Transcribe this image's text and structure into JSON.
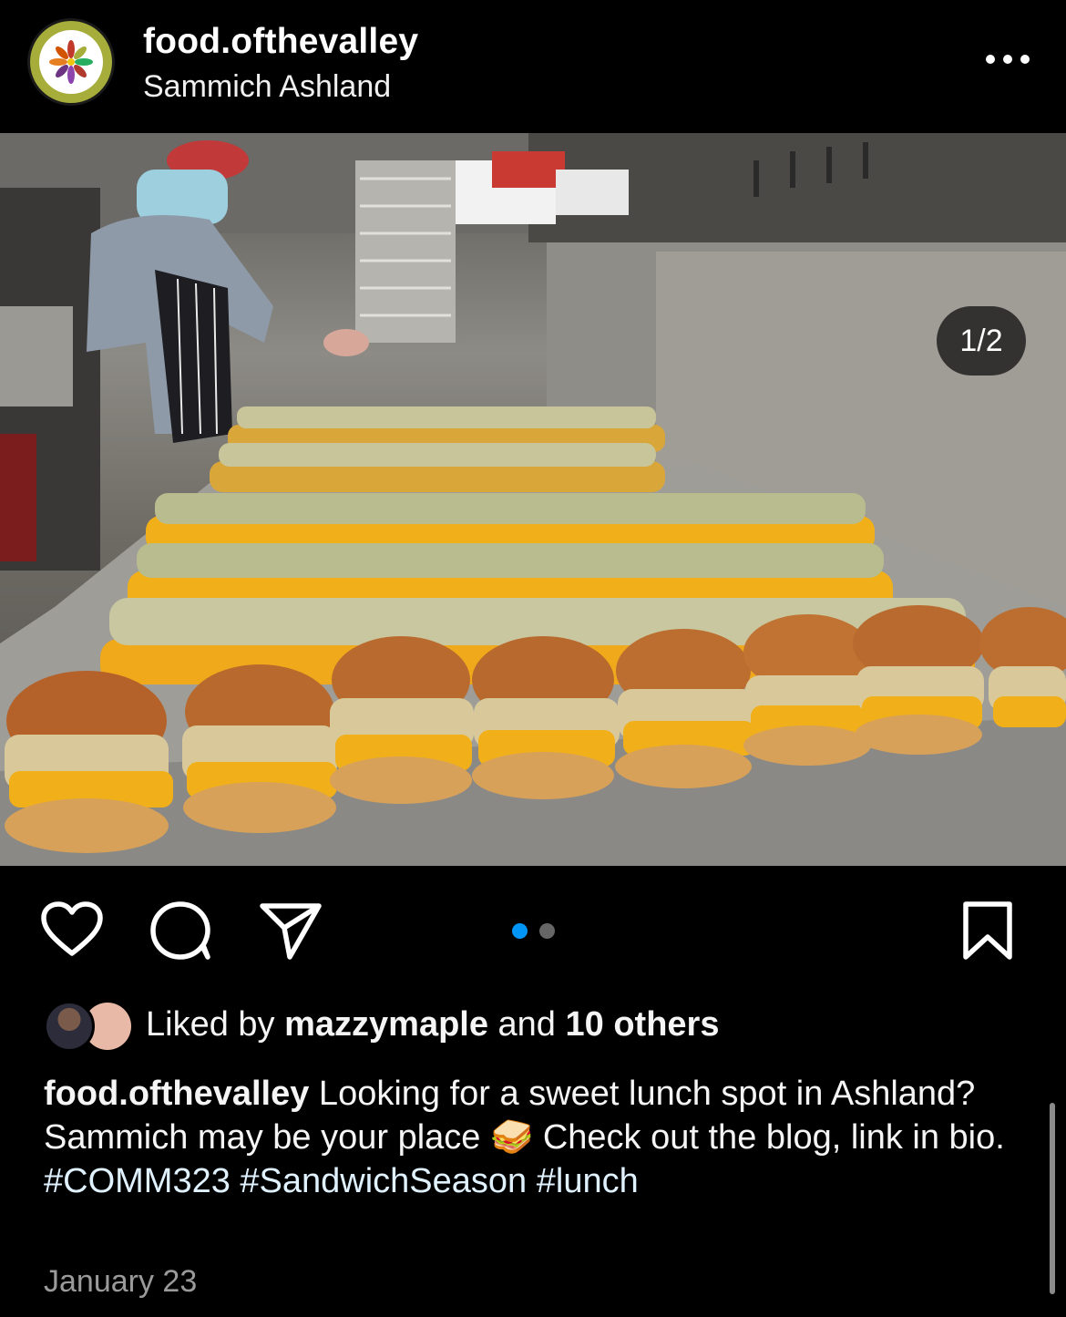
{
  "post": {
    "username": "food.ofthevalley",
    "location": "Sammich Ashland",
    "counter": "1/2"
  },
  "likes": {
    "prefix": "Liked by ",
    "user": "mazzymaple",
    "middle": " and ",
    "others": "10 others"
  },
  "caption": {
    "username": "food.ofthevalley",
    "text": " Looking for a sweet lunch spot in Ashland? Sammich may be your place 🥪 Check out the blog, link in bio. ",
    "tags": [
      "#COMM323",
      "#SandwichSeason",
      "#lunch"
    ]
  },
  "date": "January 23",
  "carousel": {
    "current": 1,
    "total": 2
  },
  "colors": {
    "accent": "#0095f6",
    "dot_inactive": "#666666",
    "hashtag": "#e0f1ff"
  },
  "icons": [
    "more-icon",
    "heart-icon",
    "comment-icon",
    "share-icon",
    "bookmark-icon"
  ]
}
